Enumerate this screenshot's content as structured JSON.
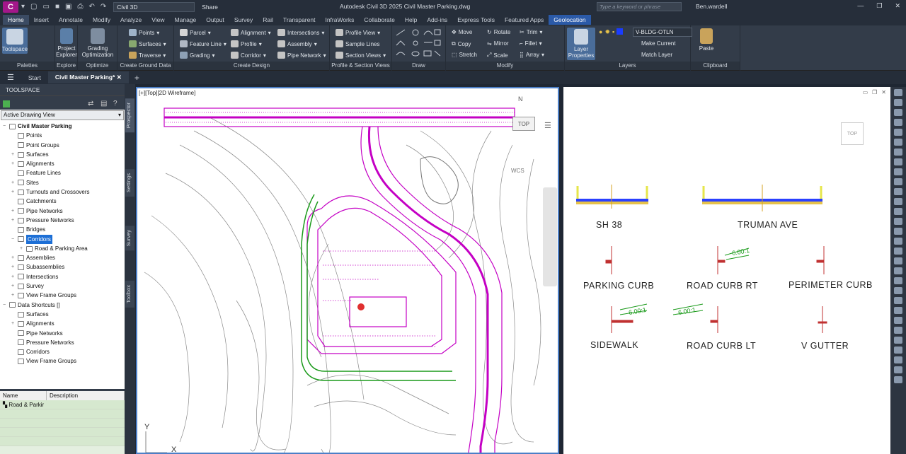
{
  "titlebar": {
    "app_letter": "C",
    "workspace": "Civil 3D",
    "share": "Share",
    "title": "Autodesk Civil 3D 2025   Civil Master Parking.dwg",
    "search_placeholder": "Type a keyword or phrase",
    "user": "Ben.wardell"
  },
  "ribbon_tabs": [
    "Home",
    "Insert",
    "Annotate",
    "Modify",
    "Analyze",
    "View",
    "Manage",
    "Output",
    "Survey",
    "Rail",
    "Transparent",
    "InfraWorks",
    "Collaborate",
    "Help",
    "Add-ins",
    "Express Tools",
    "Featured Apps",
    "Geolocation"
  ],
  "ribbon": {
    "palettes": {
      "title": "Palettes",
      "toolspace": "Toolspace"
    },
    "explore": {
      "title": "Explore",
      "project_explorer": "Project Explorer"
    },
    "optimize": {
      "title": "Optimize",
      "grading_optimization": "Grading Optimization"
    },
    "create_ground": {
      "title": "Create Ground Data",
      "points": "Points",
      "surfaces": "Surfaces",
      "traverse": "Traverse"
    },
    "create_design": {
      "title": "Create Design",
      "parcel": "Parcel",
      "feature_line": "Feature Line",
      "grading": "Grading",
      "alignment": "Alignment",
      "profile": "Profile",
      "corridor": "Corridor",
      "intersections": "Intersections",
      "assembly": "Assembly",
      "pipe_network": "Pipe Network"
    },
    "profile_section": {
      "title": "Profile & Section Views",
      "profile_view": "Profile View",
      "sample_lines": "Sample Lines",
      "section_views": "Section Views"
    },
    "draw": {
      "title": "Draw"
    },
    "modify": {
      "title": "Modify",
      "move": "Move",
      "copy": "Copy",
      "stretch": "Stretch",
      "rotate": "Rotate",
      "mirror": "Mirror",
      "scale": "Scale",
      "trim": "Trim",
      "fillet": "Fillet",
      "array": "Array"
    },
    "layers": {
      "title": "Layers",
      "layer_properties": "Layer Properties",
      "current_layer": "V-BLDG-OTLN",
      "make_current": "Make Current",
      "match_layer": "Match Layer"
    },
    "clipboard": {
      "title": "Clipboard",
      "paste": "Paste"
    }
  },
  "doc_tabs": {
    "start": "Start",
    "active": "Civil Master Parking*"
  },
  "toolspace": {
    "header": "TOOLSPACE",
    "view": "Active Drawing View",
    "tree": [
      {
        "label": "Civil Master Parking",
        "level": 0,
        "exp": "−",
        "bold": true
      },
      {
        "label": "Points",
        "level": 1,
        "exp": ""
      },
      {
        "label": "Point Groups",
        "level": 1,
        "exp": ""
      },
      {
        "label": "Surfaces",
        "level": 1,
        "exp": "+"
      },
      {
        "label": "Alignments",
        "level": 1,
        "exp": "+"
      },
      {
        "label": "Feature Lines",
        "level": 1,
        "exp": ""
      },
      {
        "label": "Sites",
        "level": 1,
        "exp": "+"
      },
      {
        "label": "Turnouts and Crossovers",
        "level": 1,
        "exp": "+"
      },
      {
        "label": "Catchments",
        "level": 1,
        "exp": ""
      },
      {
        "label": "Pipe Networks",
        "level": 1,
        "exp": "+"
      },
      {
        "label": "Pressure Networks",
        "level": 1,
        "exp": "+"
      },
      {
        "label": "Bridges",
        "level": 1,
        "exp": ""
      },
      {
        "label": "Corridors",
        "level": 1,
        "exp": "−",
        "sel": true
      },
      {
        "label": "Road & Parking Area",
        "level": 2,
        "exp": "+"
      },
      {
        "label": "Assemblies",
        "level": 1,
        "exp": "+"
      },
      {
        "label": "Subassemblies",
        "level": 1,
        "exp": "+"
      },
      {
        "label": "Intersections",
        "level": 1,
        "exp": "+"
      },
      {
        "label": "Survey",
        "level": 1,
        "exp": "+"
      },
      {
        "label": "View Frame Groups",
        "level": 1,
        "exp": "+"
      },
      {
        "label": "Data Shortcuts []",
        "level": 0,
        "exp": "−"
      },
      {
        "label": "Surfaces",
        "level": 1,
        "exp": ""
      },
      {
        "label": "Alignments",
        "level": 1,
        "exp": "+"
      },
      {
        "label": "Pipe Networks",
        "level": 1,
        "exp": ""
      },
      {
        "label": "Pressure Networks",
        "level": 1,
        "exp": ""
      },
      {
        "label": "Corridors",
        "level": 1,
        "exp": ""
      },
      {
        "label": "View Frame Groups",
        "level": 1,
        "exp": ""
      }
    ],
    "props_cols": [
      "Name",
      "Description"
    ],
    "props_row": "Road & Parkir"
  },
  "vtabs": [
    "Prospector",
    "Settings",
    "Survey",
    "Toolbox"
  ],
  "viewport": {
    "label": "[+][Top][2D Wireframe]",
    "cube": "TOP",
    "wcs": "WCS",
    "north": "N"
  },
  "sections": [
    "SH 38",
    "TRUMAN AVE",
    "PARKING CURB",
    "ROAD CURB RT",
    "PERIMETER CURB",
    "SIDEWALK",
    "ROAD CURB LT",
    "V GUTTER"
  ],
  "slopes": [
    "6.00:1",
    "6.00:1",
    "6.00:1"
  ],
  "colors": {
    "corridor": "#c400c4",
    "green": "#1a9a1a",
    "accent": "#2b5aa8"
  }
}
